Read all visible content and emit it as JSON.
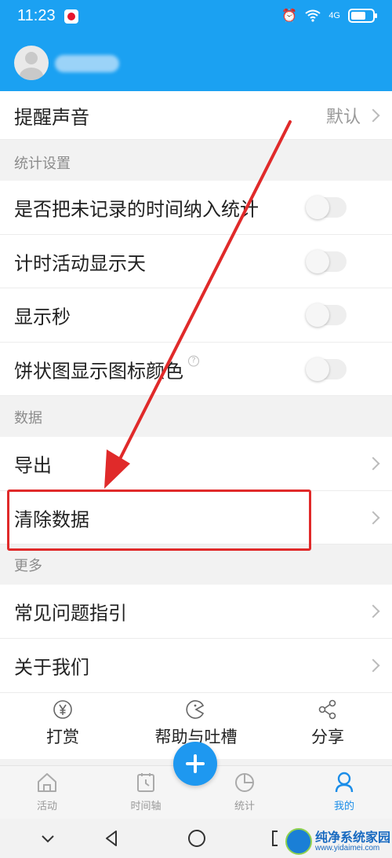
{
  "status_bar": {
    "time": "11:23",
    "network": "4G"
  },
  "settings": {
    "reminder_sound": {
      "label": "提醒声音",
      "value": "默认"
    },
    "stats_section": {
      "title": "统计设置",
      "items": [
        {
          "label": "是否把未记录的时间纳入统计",
          "enabled": false
        },
        {
          "label": "计时活动显示天",
          "enabled": false
        },
        {
          "label": "显示秒",
          "enabled": false
        },
        {
          "label": "饼状图显示图标颜色",
          "enabled": false,
          "help": "?"
        }
      ]
    },
    "data_section": {
      "title": "数据",
      "items": [
        {
          "label": "导出"
        },
        {
          "label": "清除数据"
        }
      ]
    },
    "more_section": {
      "title": "更多",
      "items": [
        {
          "label": "常见问题指引"
        },
        {
          "label": "关于我们"
        }
      ]
    }
  },
  "actions": [
    {
      "label": "打赏",
      "icon": "yen-icon"
    },
    {
      "label": "帮助与吐槽",
      "icon": "pacman-icon"
    },
    {
      "label": "分享",
      "icon": "share-icon"
    }
  ],
  "tabs": [
    {
      "label": "活动",
      "icon": "home-icon"
    },
    {
      "label": "时间轴",
      "icon": "clock-icon"
    },
    {
      "label": "统计",
      "icon": "pie-chart-icon"
    },
    {
      "label": "我的",
      "icon": "user-icon",
      "active": true
    }
  ],
  "watermark": {
    "text": "纯净系统家园",
    "url": "www.yidaimei.com"
  },
  "colors": {
    "primary": "#1ba1f2",
    "highlight": "#e02a2a",
    "active_tab": "#1b8de8"
  }
}
